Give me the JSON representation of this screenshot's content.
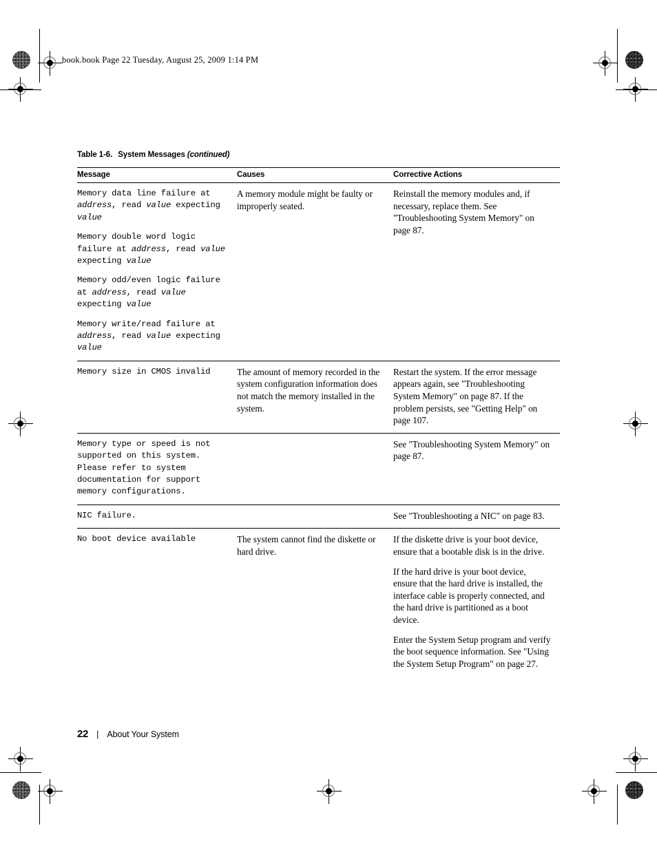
{
  "document": {
    "header_line": "book.book  Page 22  Tuesday, August 25, 2009  1:14 PM",
    "footer": {
      "page_number": "22",
      "separator": "|",
      "chapter": "About Your System"
    }
  },
  "table": {
    "caption_number": "Table 1-6.",
    "caption_title": "System Messages",
    "caption_continued": "(continued)",
    "columns": {
      "message": "Message",
      "causes": "Causes",
      "actions": "Corrective Actions"
    },
    "rows": [
      {
        "messages": [
          {
            "parts": [
              {
                "text": "Memory data line failure at ",
                "italic": false
              },
              {
                "text": "address",
                "italic": true
              },
              {
                "text": ", read ",
                "italic": false
              },
              {
                "text": "value",
                "italic": true
              },
              {
                "text": " expecting ",
                "italic": false
              },
              {
                "text": "value",
                "italic": true
              }
            ]
          },
          {
            "parts": [
              {
                "text": "Memory double word logic failure at ",
                "italic": false
              },
              {
                "text": "address",
                "italic": true
              },
              {
                "text": ", read ",
                "italic": false
              },
              {
                "text": "value",
                "italic": true
              },
              {
                "text": " expecting ",
                "italic": false
              },
              {
                "text": "value",
                "italic": true
              }
            ]
          },
          {
            "parts": [
              {
                "text": "Memory odd/even logic failure at ",
                "italic": false
              },
              {
                "text": "address",
                "italic": true
              },
              {
                "text": ", read ",
                "italic": false
              },
              {
                "text": "value",
                "italic": true
              },
              {
                "text": " expecting ",
                "italic": false
              },
              {
                "text": "value",
                "italic": true
              }
            ]
          },
          {
            "parts": [
              {
                "text": "Memory write/read failure at ",
                "italic": false
              },
              {
                "text": "address",
                "italic": true
              },
              {
                "text": ", read ",
                "italic": false
              },
              {
                "text": "value",
                "italic": true
              },
              {
                "text": " expecting ",
                "italic": false
              },
              {
                "text": "value",
                "italic": true
              }
            ]
          }
        ],
        "causes": [
          "A memory module might be faulty or improperly seated."
        ],
        "actions": [
          "Reinstall the memory modules and, if necessary, replace them. See \"Troubleshooting System Memory\" on page 87."
        ]
      },
      {
        "messages": [
          {
            "parts": [
              {
                "text": "Memory size in CMOS invalid",
                "italic": false
              }
            ]
          }
        ],
        "causes": [
          "The amount of memory recorded in the system configuration information does not match the memory installed in the system."
        ],
        "actions": [
          "Restart the system. If the error message appears again, see \"Troubleshooting System Memory\" on page 87. If the problem persists, see \"Getting Help\" on page 107."
        ]
      },
      {
        "messages": [
          {
            "parts": [
              {
                "text": "Memory type or speed is not supported on this system. Please refer to system documentation for support memory configurations.",
                "italic": false
              }
            ]
          }
        ],
        "causes": [],
        "actions": [
          "See \"Troubleshooting System Memory\" on page 87."
        ]
      },
      {
        "messages": [
          {
            "parts": [
              {
                "text": "NIC failure.",
                "italic": false
              }
            ]
          }
        ],
        "causes": [],
        "actions": [
          "See \"Troubleshooting a NIC\" on page 83."
        ]
      },
      {
        "messages": [
          {
            "parts": [
              {
                "text": "No boot device available",
                "italic": false
              }
            ]
          }
        ],
        "causes": [
          "The system cannot find the diskette or hard drive."
        ],
        "actions": [
          "If the diskette drive is your boot device, ensure that a bootable disk is in the drive.",
          "If the hard drive is your boot device, ensure that the hard drive is installed, the interface cable is properly connected, and the hard drive is partitioned as a boot device.",
          "Enter the System Setup program and verify the boot sequence information. See \"Using the System Setup Program\" on page 27."
        ]
      }
    ]
  }
}
